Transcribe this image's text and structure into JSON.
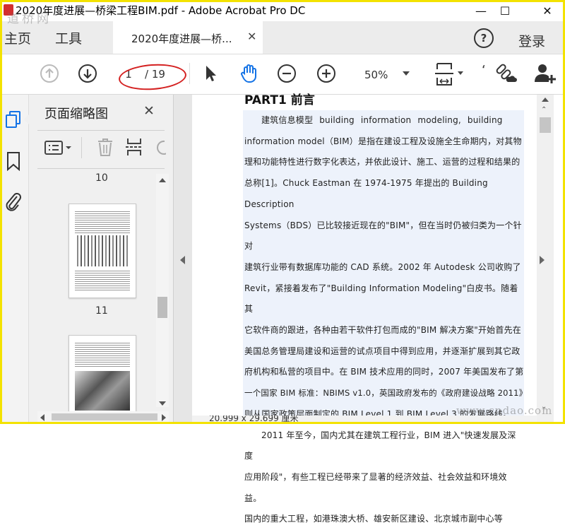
{
  "window": {
    "title": "2020年度进展—桥梁工程BIM.pdf - Adobe Acrobat Pro DC",
    "minimize": "—",
    "maximize": "☐",
    "close": "✕"
  },
  "tabs": {
    "home": "主页",
    "tools": "工具",
    "doc_tab": "2020年度进展—桥...",
    "doc_tab_close": "✕",
    "help": "?",
    "login": "登录"
  },
  "toolbar": {
    "current_page": "1",
    "total_pages": "/ 19",
    "zoom": "50%"
  },
  "panel": {
    "title": "页面缩略图",
    "close": "✕",
    "page_labels": [
      "10",
      "11"
    ]
  },
  "document": {
    "heading": "PART1 前言",
    "paragraph1_lines": [
      "建筑信息模型 building information modeling, building",
      "information model（BIM）是指在建设工程及设施全生命期内，对其物",
      "理和功能特性进行数字化表达，并依此设计、施工、运营的过程和结果的",
      "总称[1]。Chuck Eastman 在 1974-1975 年提出的 Building Description",
      "Systems（BDS）已比较接近现在的\"BIM\"，但在当时仍被归类为一个针对",
      "建筑行业带有数据库功能的 CAD 系统。2002 年 Autodesk 公司收购了",
      "Revit，紧接着发布了\"Building Information Modeling\"白皮书。随着其",
      "它软件商的跟进，各种由若干软件打包而成的\"BIM 解决方案\"开始首先在",
      "美国总务管理局建设和运营的试点项目中得到应用，并逐渐扩展到其它政",
      "府机构和私营的项目中。在 BIM 技术应用的同时，2007 年美国发布了第",
      "一个国家 BIM 标准：NBIMS v1.0，英国政府发布的《政府建设战略 2011》",
      "则从国家政策层面制定的 BIM Level 1 到 BIM Level 3 的发展路线。"
    ],
    "paragraph2_lines": [
      "2011 年至今，国内尤其在建筑工程行业，BIM 进入\"快速发展及深度",
      "应用阶段\"，有些工程已经带来了显著的经济效益、社会效益和环境效益。",
      "国内的重大工程，如港珠澳大桥、雄安新区建设、北京城市副中心等"
    ],
    "page_size": "20.999 x 29.699 厘米"
  },
  "watermarks": {
    "top_left": "道桥网",
    "bottom_right": "www.cndao.com"
  },
  "colors": {
    "highlight": "#edf2fb",
    "annotation_circle": "#d42020",
    "icon": "#333333",
    "accent_blue": "#1473e6",
    "frame": "#f3e200"
  }
}
